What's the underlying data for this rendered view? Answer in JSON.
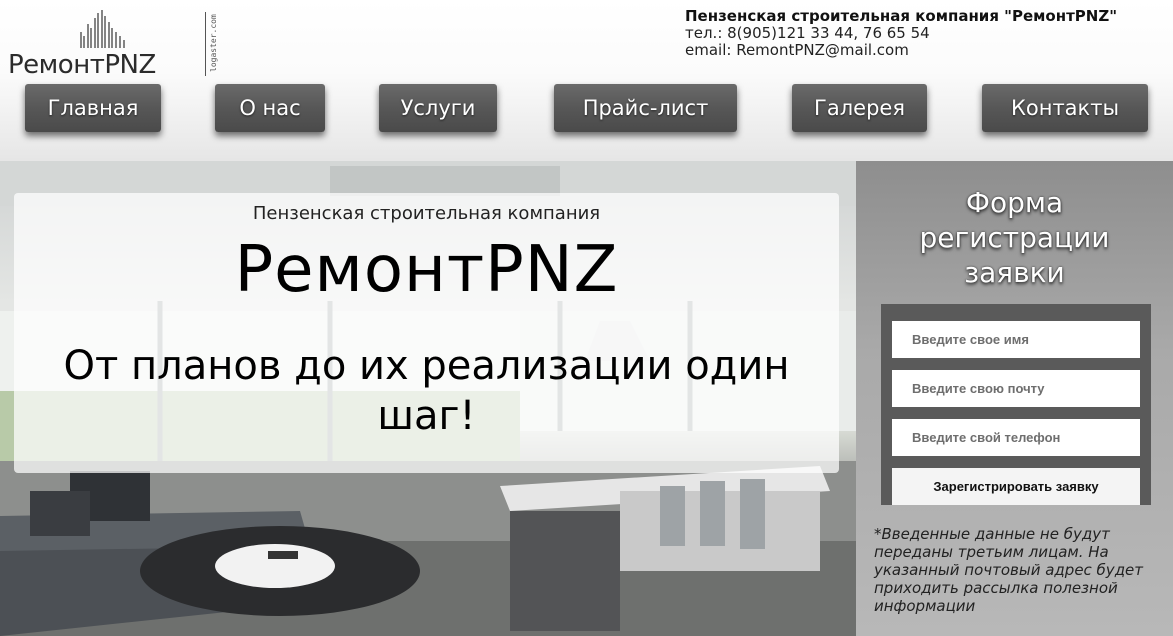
{
  "logo": {
    "name": "РемонтPNZ",
    "sub": "logaster.com"
  },
  "contacts": {
    "company": "Пензенская строительная компания \"РемонтPNZ\"",
    "phone": "тел.: 8(905)121 33 44, 76 65 54",
    "email": "email: RemontPNZ@mail.com"
  },
  "nav": {
    "items": [
      {
        "label": "Главная"
      },
      {
        "label": "О нас"
      },
      {
        "label": "Услуги"
      },
      {
        "label": "Прайс-лист"
      },
      {
        "label": "Галерея"
      },
      {
        "label": "Контакты"
      }
    ]
  },
  "hero": {
    "subtitle": "Пензенская строительная компания",
    "title": "РемонтPNZ",
    "slogan": "От планов до их реализации один шаг!"
  },
  "form": {
    "title_line1": "Форма",
    "title_line2": "регистрации",
    "title_line3": "заявки",
    "name_placeholder": "Введите свое имя",
    "email_placeholder": "Введите свою почту",
    "phone_placeholder": "Введите свой телефон",
    "submit_label": "Зарегистрировать заявку",
    "note": "*Введенные данные не будут переданы третьим лицам. На указанный почтовый адрес будет приходить рассылка полезной информации"
  },
  "colors": {
    "nav_button": "#575757",
    "form_box": "#5a5a5a",
    "sidebar": "#a9a9a9"
  }
}
